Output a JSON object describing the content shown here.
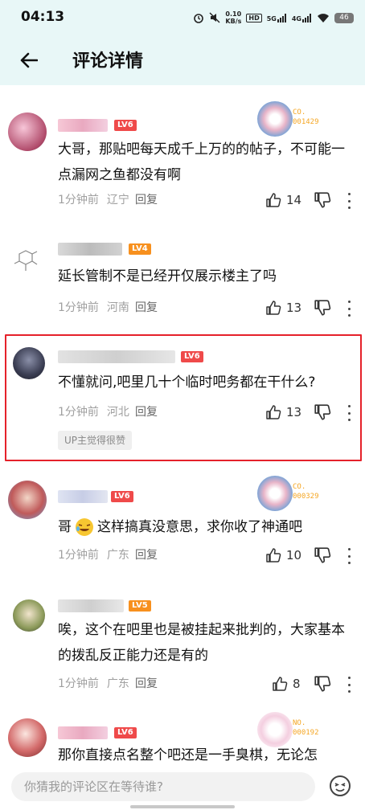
{
  "status_bar": {
    "time": "04:13",
    "speed_value": "0.10",
    "speed_unit": "KB/s",
    "hd_label": "HD",
    "net1": "5G",
    "net2": "4G",
    "battery": "46"
  },
  "header": {
    "title": "评论详情"
  },
  "comments": [
    {
      "level": "LV6",
      "level_color": "#ef4a4a",
      "badge_code": "CO.\n001429",
      "text": "大哥，那贴吧每天成千上万的的帖子，不可能一点漏网之鱼都没有啊",
      "time": "1分钟前",
      "location": "辽宁",
      "reply": "回复",
      "likes": "14"
    },
    {
      "level": "LV4",
      "level_color": "#f7901e",
      "text": "延长管制不是已经开仅展示楼主了吗",
      "time": "1分钟前",
      "location": "河南",
      "reply": "回复",
      "likes": "13"
    },
    {
      "level": "LV6",
      "level_color": "#ef4a4a",
      "text": "不懂就问,吧里几十个临时吧务都在干什么?",
      "time": "1分钟前",
      "location": "河北",
      "reply": "回复",
      "likes": "13",
      "up_tag": "UP主觉得很赞"
    },
    {
      "level": "LV6",
      "level_color": "#ef4a4a",
      "badge_code": "CO.\n000329",
      "text_before": "哥",
      "text_after": "这样搞真没意思，求你收了神通吧",
      "time": "1分钟前",
      "location": "广东",
      "reply": "回复",
      "likes": "10"
    },
    {
      "level": "LV5",
      "level_color": "#f7901e",
      "text": "唉，这个在吧里也是被挂起来批判的，大家基本的拨乱反正能力还是有的",
      "time": "1分钟前",
      "location": "广东",
      "reply": "回复",
      "likes": "8"
    },
    {
      "level": "LV6",
      "level_color": "#ef4a4a",
      "badge_code": "NO.\n000192",
      "text": "那你直接点名整个吧还是一手臭棋，无论怎",
      "time": "",
      "location": "",
      "reply": "",
      "likes": ""
    }
  ],
  "bottom": {
    "placeholder": "你猜我的评论区在等待谁?"
  },
  "colors": {
    "accent_red": "#e5212a",
    "header_bg": "#e8f7f7"
  }
}
